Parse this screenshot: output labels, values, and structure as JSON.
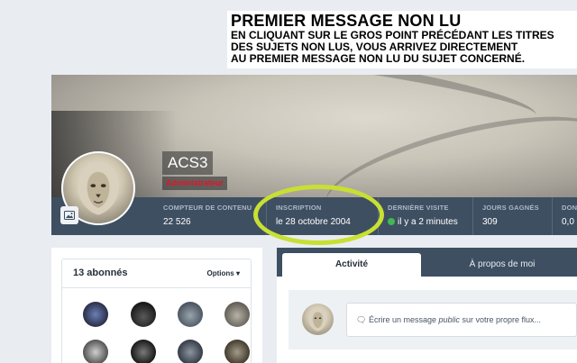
{
  "annotation": {
    "title": "PREMIER MESSAGE NON LU",
    "lines": [
      "EN CLIQUANT SUR LE GROS POINT PRÉCÉDANT LES TITRES",
      "DES SUJETS NON LUS, VOUS ARRIVEZ DIRECTEMENT",
      "AU PREMIER MESSAGE NON LU DU SUJET CONCERNÉ."
    ]
  },
  "profile": {
    "username": "ACS3",
    "role": "Administrateur"
  },
  "stats": [
    {
      "label": "COMPTEUR DE CONTENU",
      "value": "22 526"
    },
    {
      "label": "INSCRIPTION",
      "value": "le 28 octobre 2004"
    },
    {
      "label": "DERNIÈRE VISITE",
      "value": "il y a 2 minutes",
      "online": true
    },
    {
      "label": "JOURS GAGNÉS",
      "value": "309"
    },
    {
      "label": "DON",
      "value": "0,0"
    }
  ],
  "followers": {
    "title": "13 abonnés",
    "options_label": "Options"
  },
  "tabs": {
    "activity": "Activité",
    "about": "À propos de moi"
  },
  "composer": {
    "prefix": "Écrire un message ",
    "emphasis": "public",
    "suffix": " sur votre propre flux..."
  },
  "colors": {
    "stats_bar": "#3e4f62",
    "highlight": "#c7e032",
    "role": "#e0152a",
    "online": "#3fb950"
  },
  "icons": [
    "image-icon",
    "chevron-down-icon",
    "speech-bubble-icon"
  ]
}
